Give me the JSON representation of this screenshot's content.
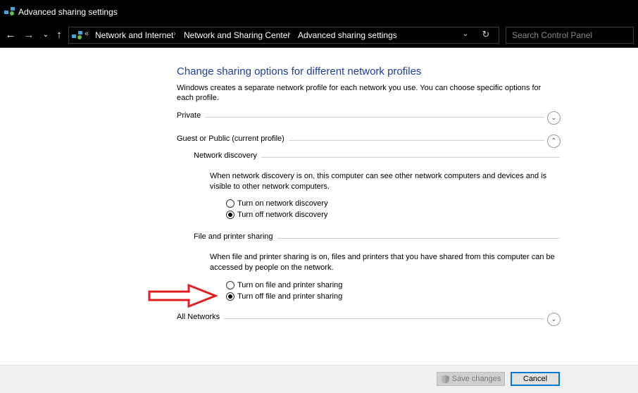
{
  "window": {
    "title": "Advanced sharing settings"
  },
  "nav": {
    "back_glyph": "←",
    "forward_glyph": "→",
    "recent_glyph": "⌄",
    "up_glyph": "↑",
    "overflow_glyph": "«",
    "dropdown_glyph": "⌄",
    "refresh_glyph": "↻"
  },
  "breadcrumb": {
    "items": [
      "Network and Internet",
      "Network and Sharing Center",
      "Advanced sharing settings"
    ],
    "separator": "›"
  },
  "search": {
    "placeholder": "Search Control Panel"
  },
  "main": {
    "heading": "Change sharing options for different network profiles",
    "intro": "Windows creates a separate network profile for each network you use. You can choose specific options for each profile.",
    "profiles": {
      "private": {
        "label": "Private",
        "state": "collapsed",
        "glyph": "⌄"
      },
      "guest": {
        "label": "Guest or Public (current profile)",
        "state": "expanded",
        "glyph": "⌃"
      },
      "all": {
        "label": "All Networks",
        "state": "collapsed",
        "glyph": "⌄"
      }
    },
    "network_discovery": {
      "title": "Network discovery",
      "description": "When network discovery is on, this computer can see other network computers and devices and is visible to other network computers.",
      "options": [
        {
          "label": "Turn on network discovery",
          "checked": false
        },
        {
          "label": "Turn off network discovery",
          "checked": true
        }
      ]
    },
    "file_printer_sharing": {
      "title": "File and printer sharing",
      "description": "When file and printer sharing is on, files and printers that you have shared from this computer can be accessed by people on the network.",
      "options": [
        {
          "label": "Turn on file and printer sharing",
          "checked": false
        },
        {
          "label": "Turn off file and printer sharing",
          "checked": true
        }
      ]
    }
  },
  "footer": {
    "save_label": "Save changes",
    "save_enabled": false,
    "cancel_label": "Cancel"
  },
  "icons": {
    "app": "network-icon",
    "shield": "uac-shield-icon",
    "annotation": "red-arrow-annotation"
  },
  "colors": {
    "heading": "#1e3f9a",
    "annotation": "#e02020",
    "focus_border": "#0078d7",
    "titlebar": "#000000"
  }
}
